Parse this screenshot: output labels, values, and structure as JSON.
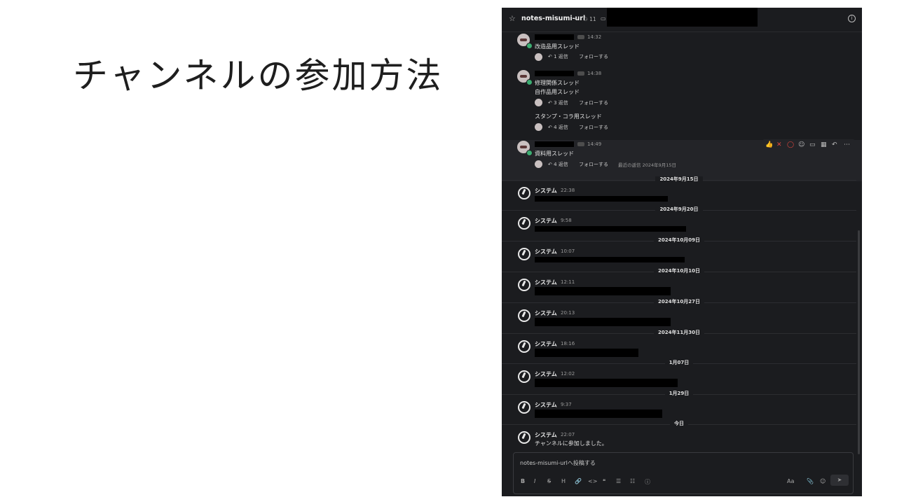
{
  "slide": {
    "title": "チャンネルの参加方法"
  },
  "header": {
    "star_icon": "☆",
    "channel_name": "notes-misumi-url",
    "chevron_icon": "⌄",
    "member_count": "11",
    "member_icon": "person-icon",
    "pin_icon": "pin-icon",
    "info_icon": "i"
  },
  "threads": [
    {
      "time": "14:32",
      "lines": [
        "改造品用スレッド"
      ],
      "replies": [
        {
          "count": "1 返信",
          "follow": "フォローする"
        }
      ]
    },
    {
      "time": "14:38",
      "lines": [
        "修理関係スレッド",
        "自作品用スレッド"
      ],
      "replies": [
        {
          "count": "3 返信",
          "follow": "フォローする"
        }
      ],
      "extra": {
        "line": "スタンプ・コラ用スレッド",
        "count": "4 返信",
        "follow": "フォローする"
      }
    },
    {
      "time": "14:49",
      "lines": [
        "資料用スレッド"
      ],
      "replies": [
        {
          "count": "4 返信",
          "follow": "フォローする",
          "recent": "最近の返信 2024年9月15日"
        }
      ]
    }
  ],
  "hover_actions": {
    "icons": [
      "thumbs-up-icon",
      "x-mark-icon",
      "red-circle-icon",
      "add-reaction-icon",
      "bookmark-icon",
      "apps-icon",
      "reply-icon",
      "more-icon"
    ],
    "glyphs": [
      "👍",
      "✕",
      "◯",
      "☺",
      "▭",
      "▦",
      "↶",
      "⋯"
    ]
  },
  "system_posts": [
    {
      "date": "2024年9月15日",
      "name": "システム",
      "time": "22:38"
    },
    {
      "date": "2024年9月20日",
      "name": "システム",
      "time": "9:58"
    },
    {
      "date": "2024年10月09日",
      "name": "システム",
      "time": "10:07"
    },
    {
      "date": "2024年10月10日",
      "name": "システム",
      "time": "12:11"
    },
    {
      "date": "2024年10月27日",
      "name": "システム",
      "time": "20:13"
    },
    {
      "date": "2024年11月30日",
      "name": "システム",
      "time": "18:16"
    },
    {
      "date": "1月07日",
      "name": "システム",
      "time": "12:02"
    },
    {
      "date": "1月29日",
      "name": "システム",
      "time": "9:37"
    },
    {
      "date": "今日",
      "name": "システム",
      "time": "22:07",
      "text": "チャンネルに参加しました。"
    }
  ],
  "composer": {
    "placeholder": "notes-misumi-urlへ投稿する",
    "toolbar": [
      "B",
      "I",
      "S",
      "H",
      "🔗",
      "<>",
      "❝",
      "☰",
      "☷",
      "ⓘ"
    ],
    "toolbar_icons": [
      "bold-icon",
      "italic-icon",
      "strike-icon",
      "heading-icon",
      "link-icon",
      "code-icon",
      "quote-icon",
      "bullet-list-icon",
      "numbered-list-icon",
      "info-icon"
    ],
    "text_format": "Aa",
    "attach": "📎",
    "emoji": "☺",
    "send": "➤"
  }
}
